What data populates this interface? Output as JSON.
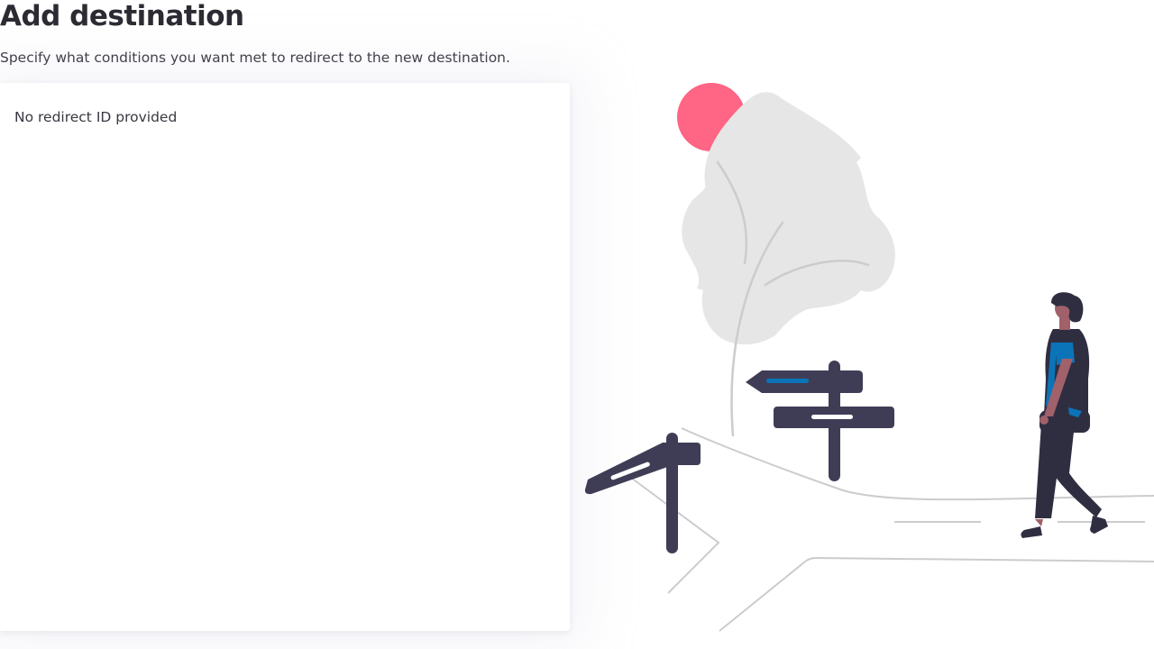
{
  "header": {
    "title": "Add destination",
    "subtitle": "Specify what conditions you want met to redirect to the new destination."
  },
  "card": {
    "message": "No redirect ID provided"
  },
  "illustration": {
    "name": "signpost-crossroads-illustration",
    "colors": {
      "sun": "#ff6584",
      "tree": "#e6e6e6",
      "tree_line": "#cccccc",
      "sign": "#3f3d56",
      "accent_blue": "#0b74b8",
      "skin": "#a0616a",
      "hair": "#2f2e41",
      "path_line": "#cccccc"
    }
  }
}
